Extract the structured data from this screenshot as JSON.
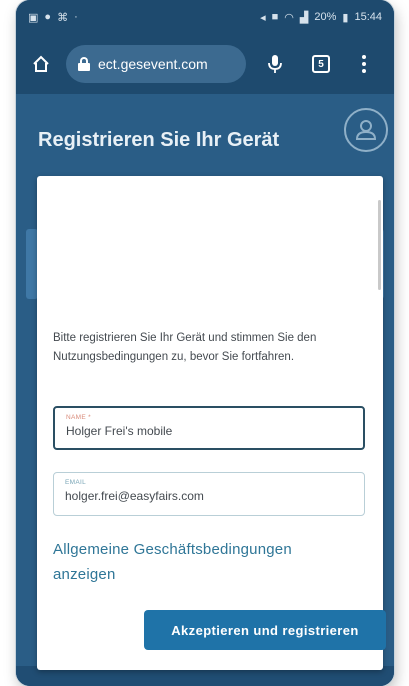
{
  "status_bar": {
    "left_icons": [
      "gallery-icon",
      "messenger-icon",
      "usb-icon",
      "dot-icon"
    ],
    "right_icons": [
      "nfc-icon",
      "mute-icon",
      "wifi-icon",
      "signal-icon"
    ],
    "battery_text": "20%",
    "time": "15:44"
  },
  "browser": {
    "url": "ect.gesevent.com",
    "tab_count": "5"
  },
  "page": {
    "title": "Registrieren Sie Ihr Gerät"
  },
  "modal": {
    "intro": "Bitte registrieren Sie Ihr Gerät und stimmen Sie den Nutzungsbedingungen zu, bevor Sie fortfahren.",
    "name_label": "NAME *",
    "name_value": "Holger Frei's mobile",
    "email_label": "EMAIL",
    "email_value": "holger.frei@easyfairs.com",
    "terms_link": "Allgemeine Geschäftsbedingungen anzeigen",
    "accept_button": "Akzeptieren und registrieren"
  },
  "colors": {
    "brand_dark": "#1e4a6e",
    "page_bg": "#2a5d86",
    "button": "#1f73a8",
    "link": "#2f7697"
  }
}
